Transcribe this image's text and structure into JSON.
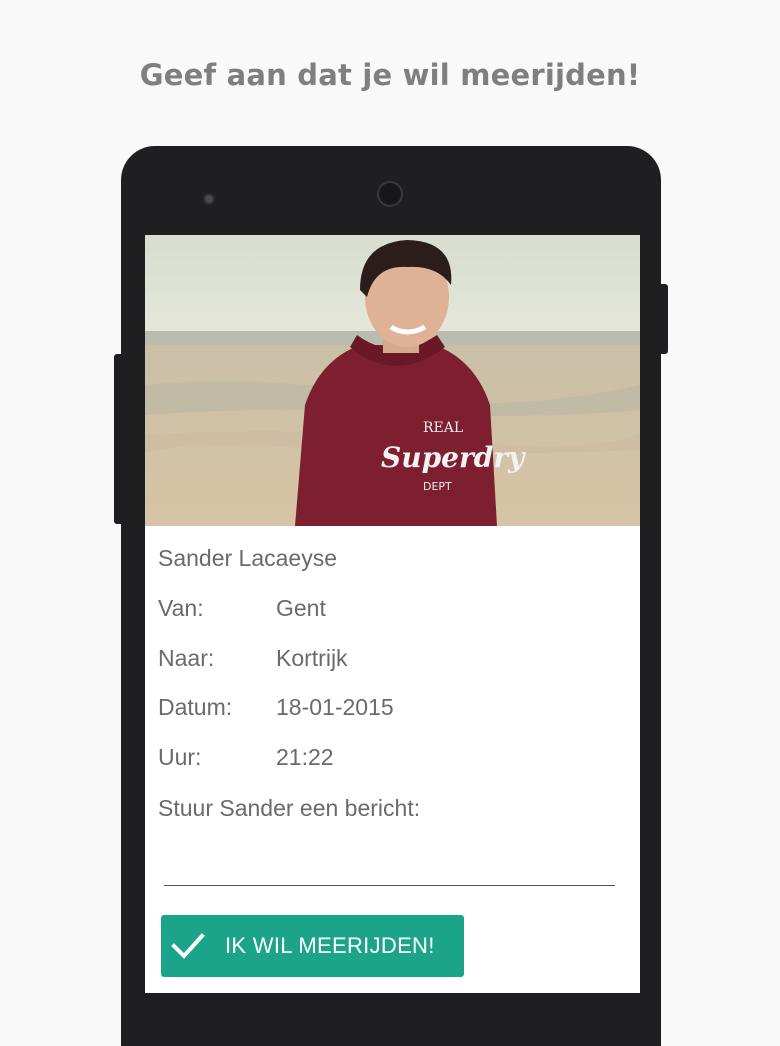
{
  "header": {
    "title": "Geef aan dat je wil meerijden!"
  },
  "ride": {
    "driver_name": "Sander Lacaeyse",
    "fields": [
      {
        "label": "Van:",
        "value": "Gent"
      },
      {
        "label": "Naar:",
        "value": "Kortrijk"
      },
      {
        "label": "Datum:",
        "value": "18-01-2015"
      },
      {
        "label": "Uur:",
        "value": "21:22"
      }
    ],
    "message_label": "Stuur Sander een bericht:",
    "message_value": "",
    "message_placeholder": ""
  },
  "actions": {
    "join_label": "IK WIL MEERIJDEN!",
    "join_icon": "check-icon"
  },
  "colors": {
    "accent": "#1ba48a",
    "text": "#6a6a6a",
    "headline": "#7f7f7f",
    "phone": "#1f1f22"
  }
}
